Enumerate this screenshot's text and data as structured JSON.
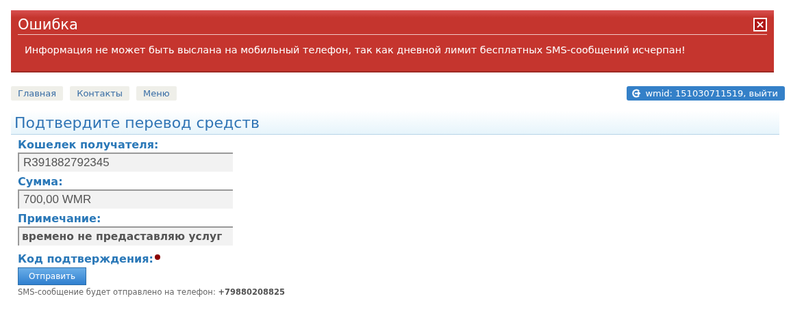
{
  "error": {
    "title": "Ошибка",
    "close": "×",
    "message": "Информация не может быть выслана на мобильный телефон, так как дневной лимит бесплатных SMS-сообщений исчерпан!"
  },
  "nav": [
    "Главная",
    "Контакты",
    "Меню"
  ],
  "logout": "wmid: 151030711519, выйти",
  "heading": "Подтвердите перевод средств",
  "fields": [
    {
      "label": "Кошелек получателя:",
      "value": "R391882792345"
    },
    {
      "label": "Сумма:",
      "value": "700,00 WMR"
    },
    {
      "label": "Примечание:",
      "value": "времено не предаставляю услуг"
    }
  ],
  "code": {
    "label": "Код подтверждения:",
    "required": true
  },
  "submit": "Отправить",
  "note": "SMS-сообщение будет отправлено на телефон: **+79880208825**"
}
